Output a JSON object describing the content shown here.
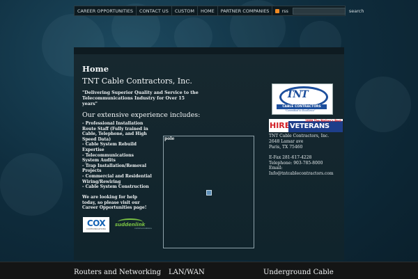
{
  "nav": {
    "items": [
      "CAREER OPPORTUNITIES",
      "CONTACT US",
      "CUSTOM",
      "HOME",
      "PARTNER COMPANIES"
    ],
    "rss_label": "rss",
    "search_value": "",
    "search_label": "search"
  },
  "main": {
    "page_title": "Home",
    "company_name": "TNT Cable Contractors, Inc.",
    "tagline": "\"Delivering Superior Quality and Service to the Telecommunications Industry for Over 15 years\"",
    "experience_heading": "Our extensive experience includes:",
    "services": [
      "- Professional Installation Route Staff (Fully trained in Cable, Telephone, and High Speed Data)",
      "- Cable System Rebuild Expertise",
      "- Telecommunications System Audits",
      "- Trap Installation/Removal Projects",
      "- Commercial and Residential Wiring/Rewiring",
      "- Cable System Construction"
    ],
    "help_text": "We are looking for help today, so please visit our Career Opportunities page!",
    "image_label": "pole",
    "partner_logos": {
      "cox": "COX",
      "cox_sub": "COMMUNICATIONS",
      "suddenlink": "suddenlink",
      "suddenlink_sub": "communications"
    }
  },
  "sidebar": {
    "tnt_logo_text": "TNT",
    "tnt_logo_bar": "CABLE CONTRACTORS",
    "tnt_logo_motto": "\"Committed to Excellence\"",
    "hire_logo_left": "HIRE",
    "hire_logo_right": "VETERANS",
    "hire_logo_tag": "2009 The Nation's Best",
    "contact": {
      "name": "TNT Cable Contractors, Inc.",
      "address1": "2648 Lamar ave",
      "address2": "Paris, TX 75460",
      "fax": "E-Fax 281-617-4228",
      "phone": "Telephone: 903-785-8000",
      "email_label": "Email:",
      "email": "Info@tntcablecontractors.com"
    }
  },
  "footer": {
    "col1": "Routers and Networking",
    "col2": "LAN/WAN",
    "col3": "Underground Cable"
  },
  "colors": {
    "background": "#0f2e3f",
    "panel": "#14262d",
    "cox_blue": "#1463b5",
    "tnt_blue": "#1d4f9c",
    "hire_red": "#d21f26",
    "suddenlink_green": "#7ac143"
  }
}
